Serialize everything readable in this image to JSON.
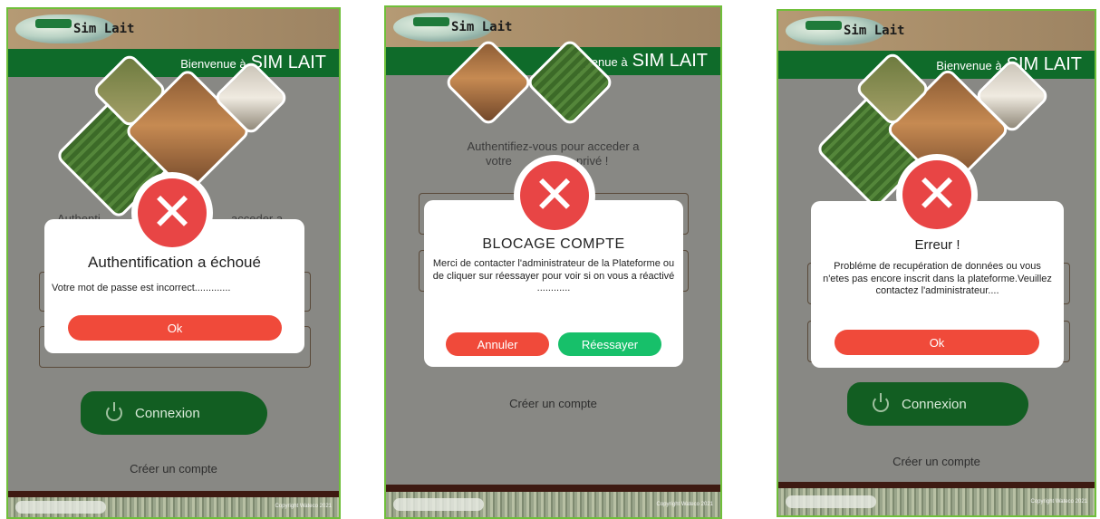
{
  "app": {
    "logo_text": "Sim Lait",
    "welcome_prefix": "Bienvenue à",
    "welcome_brand": "SIM LAIT",
    "auth_prompt": "Authentifiez-vous pour acceder a votre espace privé !",
    "connexion_label": "Connexion",
    "create_account": "Créer un compte",
    "copyright": "Copyright Wateco 2021"
  },
  "screens": [
    {
      "auth_fragment_left": "Authenti",
      "auth_fragment_right": "acceder a",
      "dialog": {
        "icon": "close-icon",
        "title": "Authentification a échoué",
        "message": "Votre mot de passe est incorrect.............",
        "button": "Ok"
      }
    },
    {
      "auth_line1": "Authentifiez-vous pour acceder a",
      "auth_line2_left": "votre",
      "auth_line2_right": "privé !",
      "dialog": {
        "icon": "close-icon",
        "title": "BLOCAGE COMPTE",
        "message": "Merci de contacter l'administrateur de la Plateforme ou de cliquer sur réessayer pour voir si on vous a réactivé ............",
        "cancel": "Annuler",
        "retry": "Réessayer"
      }
    },
    {
      "dialog": {
        "icon": "close-icon",
        "title": "Erreur !",
        "message": "Probléme de recupération de données ou vous n'etes pas encore inscrit dans la plateforme.Veuillez contactez l'administrateur....",
        "button": "Ok"
      }
    }
  ],
  "colors": {
    "accent_green": "#0f6b2a",
    "error_red": "#e84545",
    "retry_green": "#17c06a",
    "frame_border": "#6fbf3a"
  }
}
